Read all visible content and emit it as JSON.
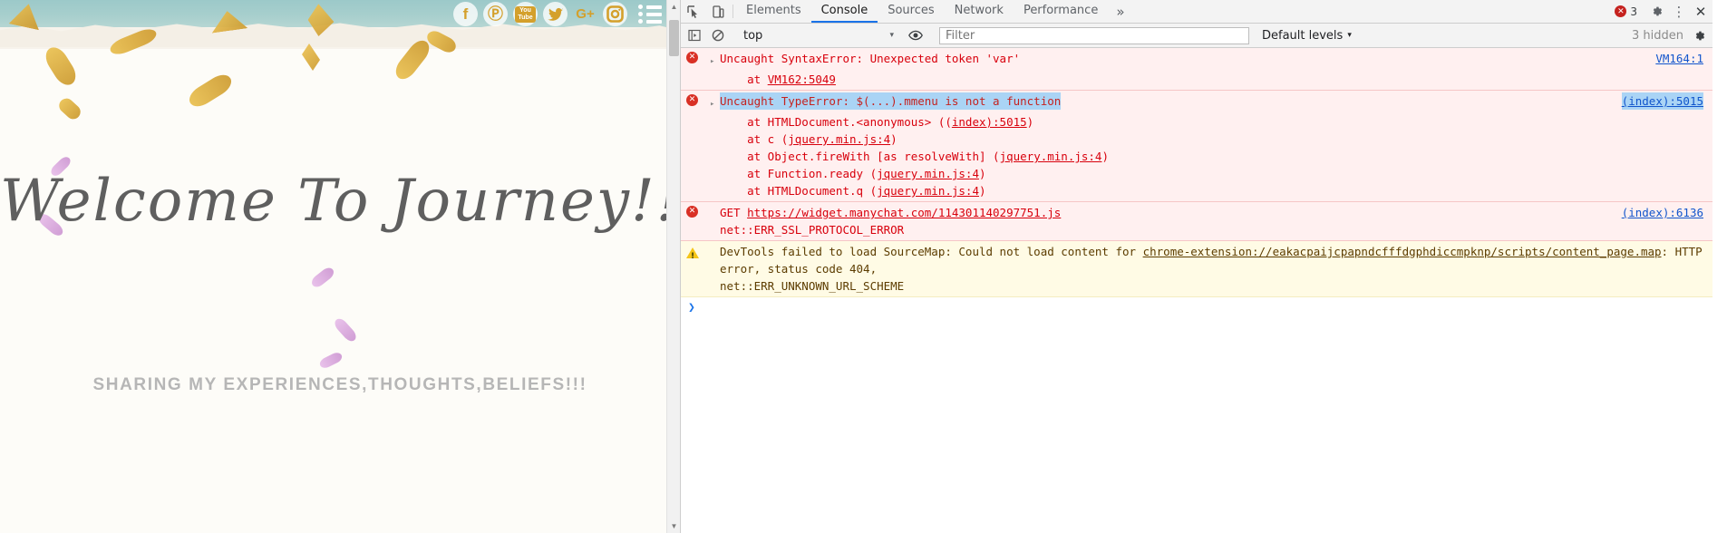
{
  "site": {
    "welcome_heading": "Welcome To Journey!!!",
    "tagline": "SHARING MY EXPERIENCES,THOUGHTS,BELIEFS!!!",
    "social": [
      {
        "name": "facebook-icon",
        "label": "f"
      },
      {
        "name": "pinterest-icon",
        "label": "Ⓟ"
      },
      {
        "name": "youtube-icon",
        "label": "You Tube"
      },
      {
        "name": "twitter-icon",
        "label": "🐦"
      },
      {
        "name": "google-plus-icon",
        "label": "G+"
      },
      {
        "name": "instagram-icon",
        "label": "▣"
      }
    ],
    "menu_label": "Menu"
  },
  "devtools": {
    "tabs": [
      {
        "label": "Elements",
        "active": false
      },
      {
        "label": "Console",
        "active": true
      },
      {
        "label": "Sources",
        "active": false
      },
      {
        "label": "Network",
        "active": false
      },
      {
        "label": "Performance",
        "active": false
      }
    ],
    "more_tabs_label": "»",
    "error_count": "3",
    "settings_label": "Settings",
    "kebab_label": "⋮",
    "close_label": "✕",
    "toolbar": {
      "context": "top",
      "context_caret": "▾",
      "filter_placeholder": "Filter",
      "filter_value": "",
      "levels_label": "Default levels",
      "levels_caret": "▾",
      "hidden_label": "3 hidden"
    },
    "console": {
      "messages": [
        {
          "level": "error",
          "icon": "error-circle-icon",
          "expandable": true,
          "title": "Uncaught SyntaxError: Unexpected token 'var'",
          "title_selected": false,
          "source": "VM164:1",
          "source_selected": false,
          "stack": [
            {
              "prefix": "    at ",
              "link": "VM162:5049",
              "suffix": ""
            }
          ],
          "extra": []
        },
        {
          "level": "error",
          "icon": "error-circle-icon",
          "expandable": true,
          "title": "Uncaught TypeError: $(...).mmenu is not a function",
          "title_selected": true,
          "source": "(index):5015",
          "source_selected": true,
          "stack": [
            {
              "prefix": "    at HTMLDocument.<anonymous> ((",
              "link": "index):5015",
              "suffix": ")"
            },
            {
              "prefix": "    at c (",
              "link": "jquery.min.js:4",
              "suffix": ")"
            },
            {
              "prefix": "    at Object.fireWith [as resolveWith] (",
              "link": "jquery.min.js:4",
              "suffix": ")"
            },
            {
              "prefix": "    at Function.ready (",
              "link": "jquery.min.js:4",
              "suffix": ")"
            },
            {
              "prefix": "    at HTMLDocument.q (",
              "link": "jquery.min.js:4",
              "suffix": ")"
            }
          ],
          "extra": []
        },
        {
          "level": "error",
          "icon": "error-circle-icon",
          "expandable": false,
          "title": "GET ",
          "title_link": "https://widget.manychat.com/114301140297751.js",
          "title_selected": false,
          "source": "(index):6136",
          "source_selected": false,
          "stack": [],
          "extra": [
            "net::ERR_SSL_PROTOCOL_ERROR"
          ]
        },
        {
          "level": "warn",
          "icon": "warning-triangle-icon",
          "expandable": false,
          "title": "DevTools failed to load SourceMap: Could not load content for ",
          "title_link": "chrome-extension://eakacpaijcpapndcfffdgphdiccmpknp/scripts/content_page.map",
          "title_tail": ": HTTP error, status code 404,",
          "title_selected": false,
          "source": "",
          "source_selected": false,
          "stack": [],
          "extra": [
            "net::ERR_UNKNOWN_URL_SCHEME"
          ]
        }
      ],
      "prompt_symbol": "❯"
    }
  },
  "colors": {
    "error_bg": "#fff0f0",
    "error_text": "#d8000c",
    "warn_bg": "#fffbe5",
    "accent_tab": "#1a73e8",
    "selection": "#aad4f5",
    "site_gold": "#d4a02c",
    "site_teal": "#9cc9c9"
  }
}
